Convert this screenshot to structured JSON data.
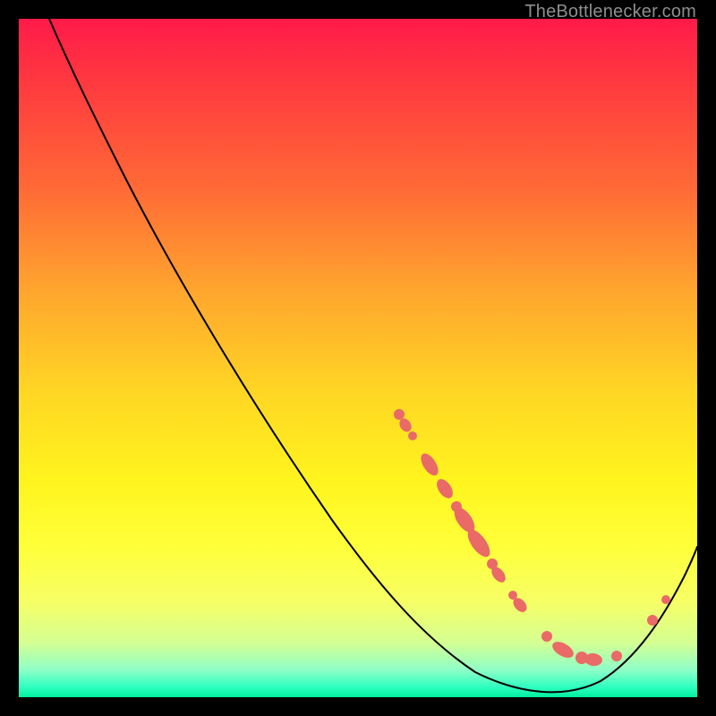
{
  "attribution": "TheBottlenecker.com",
  "colors": {
    "marker": "#e96a66",
    "curve": "#000000",
    "frame": "#000000"
  },
  "chart_data": {
    "type": "line",
    "title": "",
    "xlabel": "",
    "ylabel": "",
    "xlim": [
      0,
      100
    ],
    "ylim": [
      0,
      100
    ],
    "series": [
      {
        "name": "bottleneck-curve",
        "x": [
          0,
          5,
          10,
          15,
          20,
          25,
          30,
          35,
          40,
          45,
          50,
          55,
          60,
          65,
          70,
          75,
          80,
          85,
          90,
          95,
          100
        ],
        "y": [
          100,
          97,
          92,
          86,
          79,
          72,
          65,
          58,
          51,
          44,
          37,
          30,
          23,
          16,
          10,
          5,
          1,
          0,
          4,
          12,
          22
        ]
      }
    ],
    "markers": {
      "note": "Highlighted sample points along the curve (percent x positions).",
      "x": [
        56,
        57,
        60,
        61,
        63,
        64,
        65,
        66,
        67,
        68,
        69,
        72,
        75,
        78,
        80,
        83,
        85,
        92,
        94
      ]
    },
    "annotations": []
  }
}
